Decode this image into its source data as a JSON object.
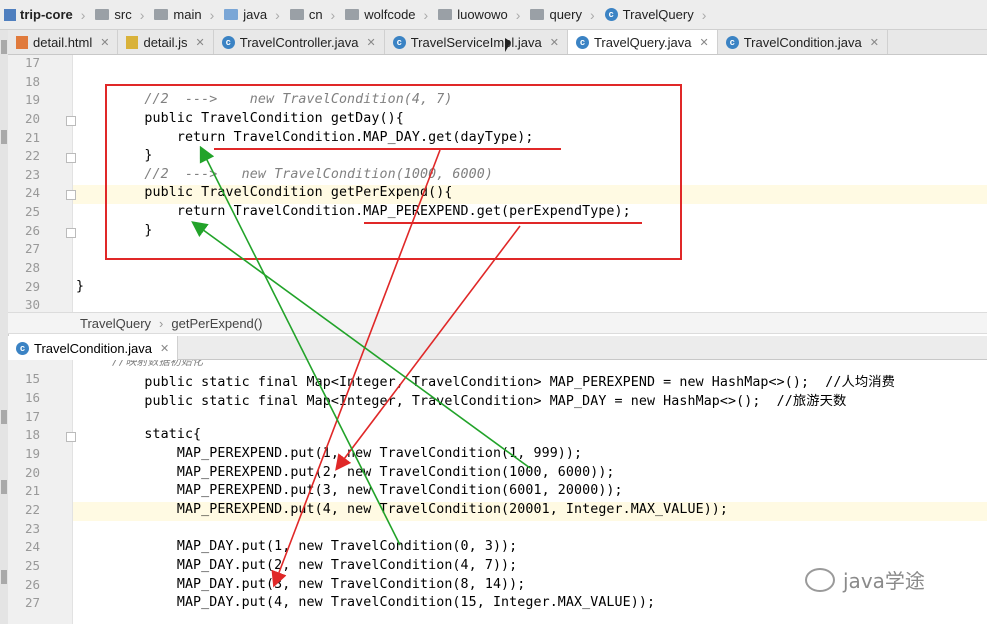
{
  "breadcrumb": [
    "trip-core",
    "src",
    "main",
    "java",
    "cn",
    "wolfcode",
    "luowowo",
    "query",
    "TravelQuery"
  ],
  "tabs": [
    "detail.html",
    "detail.js",
    "TravelController.java",
    "TravelServiceImpl.java",
    "TravelQuery.java",
    "TravelCondition.java"
  ],
  "active_tab": "TravelQuery.java",
  "structure_path": [
    "TravelQuery",
    "getPerExpend()"
  ],
  "lower_tab": "TravelCondition.java",
  "top_editor": {
    "line_numbers": [
      "17",
      "18",
      "19",
      "20",
      "21",
      "22",
      "23",
      "24",
      "25",
      "26",
      "27",
      "28",
      "29",
      "30"
    ],
    "lines": [
      "",
      "",
      "    //2  --->    new TravelCondition(4, 7)",
      "    public TravelCondition getDay(){",
      "        return TravelCondition.MAP_DAY.get(dayType);",
      "    }",
      "    //2  --->   new TravelCondition(1000, 6000)",
      "    public TravelCondition getPerExpend(){",
      "        return TravelCondition.MAP_PEREXPEND.get(perExpendType);",
      "    }",
      "",
      "",
      "}",
      ""
    ]
  },
  "bottom_editor": {
    "line_numbers": [
      "15",
      "16",
      "17",
      "18",
      "19",
      "20",
      "21",
      "22",
      "23",
      "24",
      "25",
      "26",
      "27"
    ],
    "header_comment": "//映射数据初始化",
    "lines": [
      "    public static final Map<Integer, TravelCondition> MAP_PEREXPEND = new HashMap<>();  //人均消费",
      "    public static final Map<Integer, TravelCondition> MAP_DAY = new HashMap<>();  //旅游天数",
      "",
      "    static{",
      "        MAP_PEREXPEND.put(1, new TravelCondition(1, 999));",
      "        MAP_PEREXPEND.put(2, new TravelCondition(1000, 6000));",
      "        MAP_PEREXPEND.put(3, new TravelCondition(6001, 20000));",
      "        MAP_PEREXPEND.put(4, new TravelCondition(20001, Integer.MAX_VALUE));",
      "",
      "        MAP_DAY.put(1, new TravelCondition(0, 3));",
      "        MAP_DAY.put(2, new TravelCondition(4, 7));",
      "        MAP_DAY.put(3, new TravelCondition(8, 14));",
      "        MAP_DAY.put(4, new TravelCondition(15, Integer.MAX_VALUE));"
    ]
  },
  "watermark": "java学途",
  "colors": {
    "annotation_red": "#e02828",
    "annotation_green": "#22a32a",
    "keyword": "#000080",
    "constant": "#660e7a",
    "number": "#0000ff"
  },
  "icons": [
    "module-icon",
    "folder-icon",
    "class-icon",
    "html-file-icon",
    "js-file-icon",
    "close-icon",
    "fold-icon",
    "wechat-icon"
  ]
}
